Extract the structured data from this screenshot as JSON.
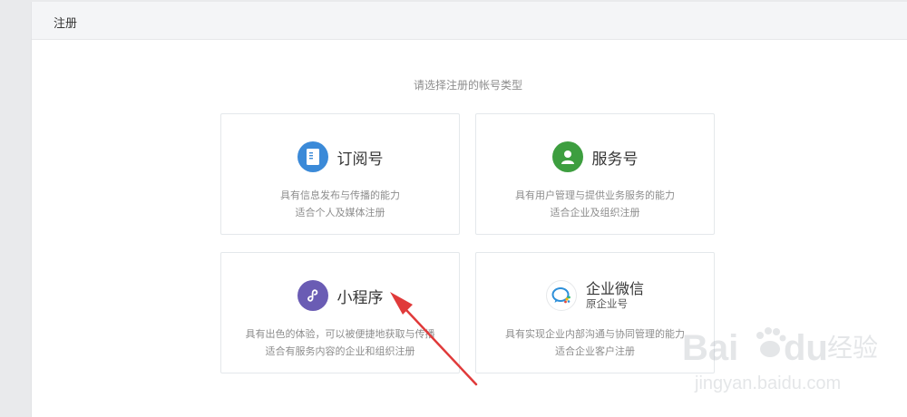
{
  "panel": {
    "title": "注册"
  },
  "prompt": "请选择注册的帐号类型",
  "cards": [
    {
      "name": "订阅号",
      "desc1": "具有信息发布与传播的能力",
      "desc2": "适合个人及媒体注册",
      "icon": "document-icon",
      "color": "#3b8ad8"
    },
    {
      "name": "服务号",
      "desc1": "具有用户管理与提供业务服务的能力",
      "desc2": "适合企业及组织注册",
      "icon": "user-icon",
      "color": "#3d9e3f"
    },
    {
      "name": "小程序",
      "desc1": "具有出色的体验，可以被便捷地获取与传播",
      "desc2": "适合有服务内容的企业和组织注册",
      "icon": "miniprogram-icon",
      "color": "#6a5cb4"
    },
    {
      "name": "企业微信",
      "sub": "原企业号",
      "desc1": "具有实现企业内部沟通与协同管理的能力",
      "desc2": "适合企业客户注册",
      "icon": "work-chat-icon",
      "color": "#2d8fd9"
    }
  ],
  "watermark": {
    "brand_left": "Bai",
    "brand_right": "du",
    "brand_cn": "经验",
    "url": "jingyan.baidu.com"
  }
}
